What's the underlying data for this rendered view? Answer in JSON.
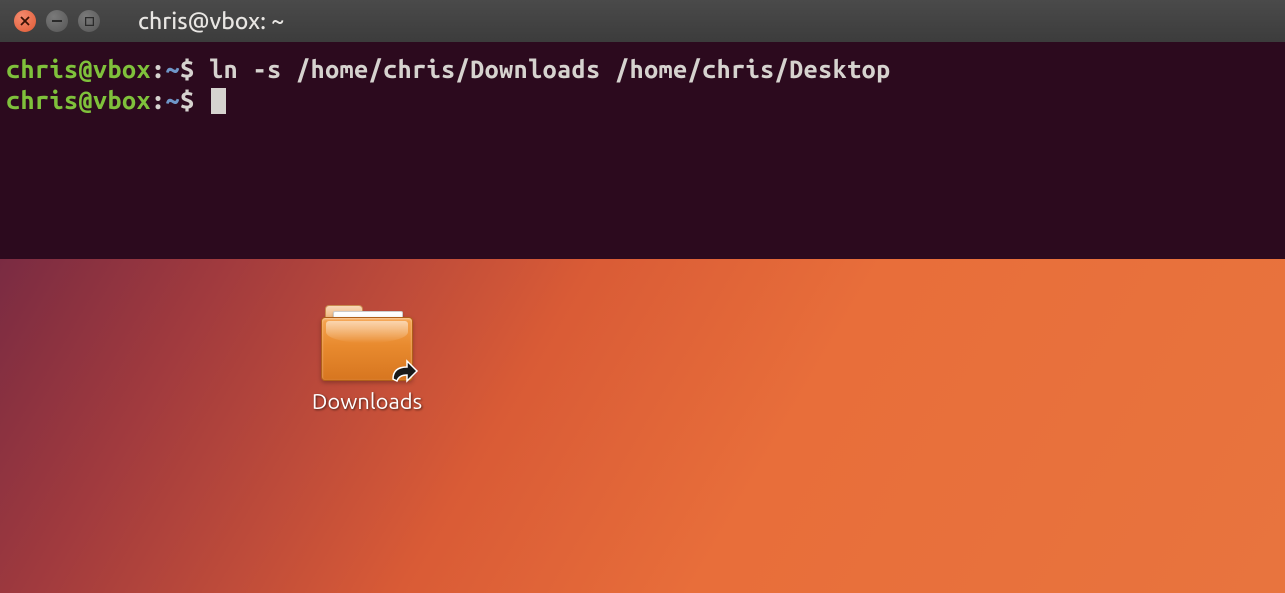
{
  "window": {
    "title": "chris@vbox: ~"
  },
  "terminal": {
    "lines": [
      {
        "user": "chris@vbox",
        "colon": ":",
        "tilde": "~",
        "dollar": "$ ",
        "command": "ln -s /home/chris/Downloads /home/chris/Desktop"
      },
      {
        "user": "chris@vbox",
        "colon": ":",
        "tilde": "~",
        "dollar": "$ ",
        "command": ""
      }
    ]
  },
  "desktop": {
    "icon_label": "Downloads"
  }
}
